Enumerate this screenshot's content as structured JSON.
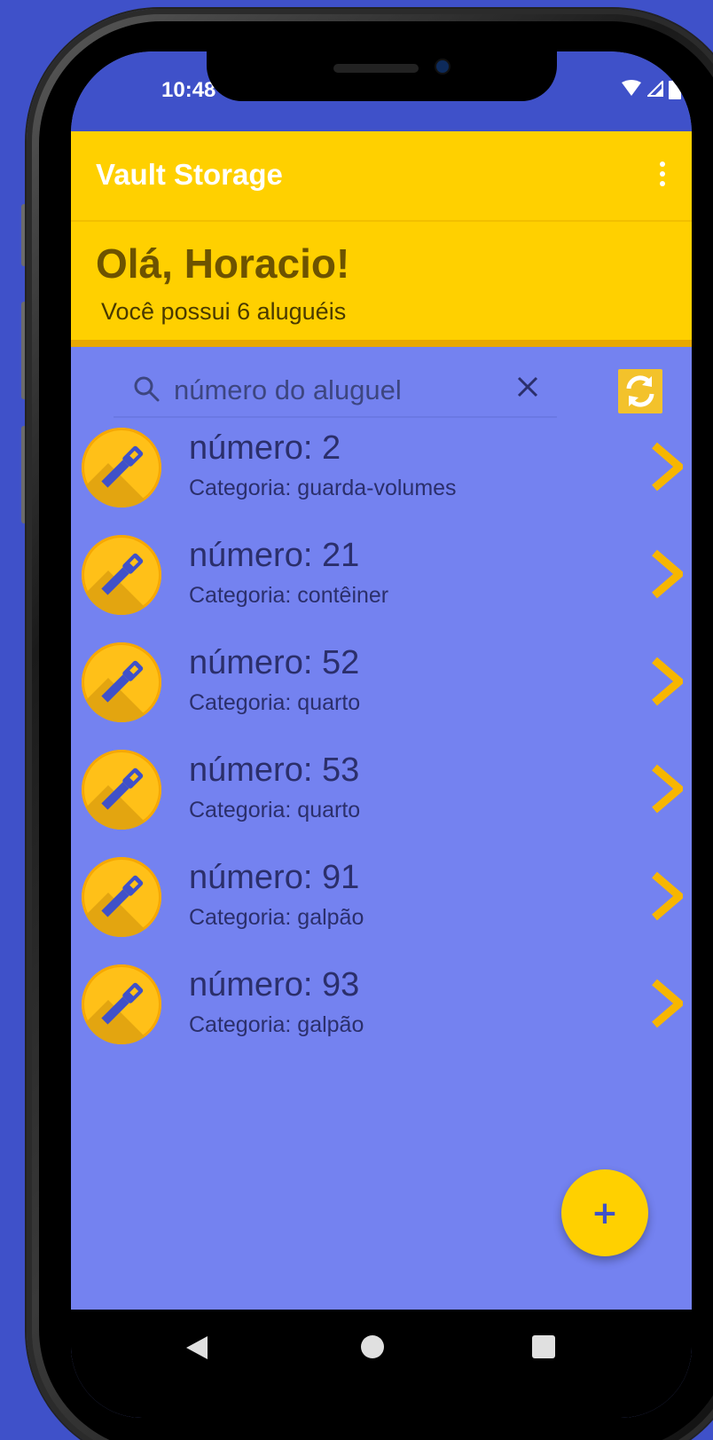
{
  "status_bar": {
    "time": "10:48",
    "icons": [
      "wifi-icon",
      "signal-icon",
      "battery-icon"
    ]
  },
  "app_bar": {
    "title": "Vault Storage",
    "menu_icon": "overflow-menu-icon"
  },
  "greeting": {
    "title": "Olá, Horacio!",
    "subtitle": "Você possui 6 aluguéis"
  },
  "search": {
    "placeholder": "número do aluguel",
    "value": "",
    "clear_icon": "close-icon",
    "refresh_icon": "refresh-icon"
  },
  "rentals": [
    {
      "number": "número: 2",
      "category": "Categoria: guarda-volumes"
    },
    {
      "number": "número: 21",
      "category": "Categoria: contêiner"
    },
    {
      "number": "número: 52",
      "category": "Categoria: quarto"
    },
    {
      "number": "número: 53",
      "category": "Categoria: quarto"
    },
    {
      "number": "número: 91",
      "category": "Categoria: galpão"
    },
    {
      "number": "número: 93",
      "category": "Categoria: galpão"
    }
  ],
  "fab": {
    "label": "+",
    "icon": "add-icon"
  },
  "nav": {
    "icons": [
      "back-icon",
      "home-icon",
      "recents-icon"
    ]
  },
  "colors": {
    "primary": "#3f51c9",
    "accent": "#ffd000",
    "list_background": "#7482f0",
    "text_dark": "#2b2f6b"
  }
}
